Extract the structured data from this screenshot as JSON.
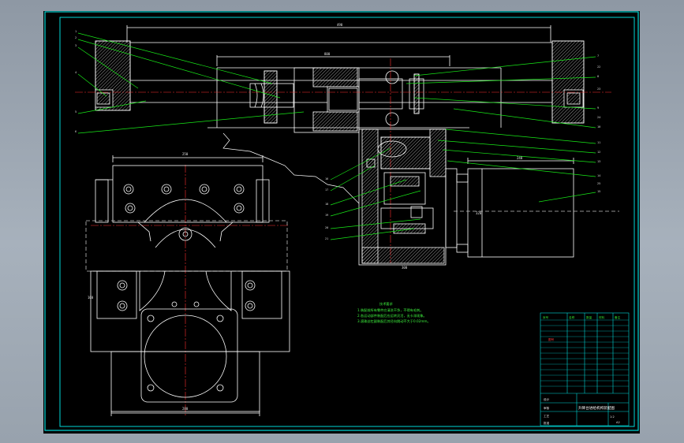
{
  "drawing": {
    "colors": {
      "outline": "#ffffff",
      "frame": "#00d9d9",
      "centerline": "#ff3030",
      "leader": "#18e818",
      "hatch": "#d8d8d8",
      "hidden": "#bfbfbf"
    },
    "dimensions": {
      "overall_length": "490",
      "upper_span": "800",
      "base_width": "300",
      "plan_top_width": "250",
      "plan_bottom_width": "280",
      "motor_length": "240",
      "gearbox_height": "320",
      "side_height": "160"
    },
    "balloons": [
      "1",
      "2",
      "3",
      "4",
      "5",
      "6",
      "7",
      "8",
      "9",
      "10",
      "11",
      "12",
      "13",
      "14",
      "15",
      "16",
      "17",
      "18",
      "19",
      "20",
      "21",
      "22",
      "23",
      "24",
      "25"
    ],
    "notes": {
      "title": "技术要求",
      "lines": [
        "1.装配前所有零件应清洗干净，不得有毛刺。",
        "2.各运动部件装配后应运转灵活，无卡滞现象。",
        "3.滚珠丝杠副装配后其径向跳动不大于0.02mm。"
      ]
    },
    "title_block": {
      "name": "升降台进给机构装配图",
      "sheet": "A2",
      "scale": "1:2",
      "unit": "图号",
      "header_labels": [
        "序号",
        "名称",
        "数量",
        "材料",
        "备注"
      ],
      "sign_labels": [
        "设计",
        "审核",
        "工艺",
        "批准"
      ]
    }
  }
}
